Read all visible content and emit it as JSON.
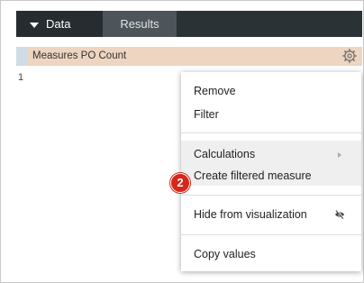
{
  "tabs": [
    {
      "label": "Data",
      "active": true
    },
    {
      "label": "Results",
      "active": false
    }
  ],
  "header": {
    "measure_label": "Measures PO Count"
  },
  "row_number": "1",
  "menu": {
    "remove": "Remove",
    "filter": "Filter",
    "calculations": "Calculations",
    "create_filtered_measure": "Create filtered measure",
    "hide_from_visualization": "Hide from visualization",
    "copy_values": "Copy values"
  },
  "step_badge": "2",
  "colors": {
    "tab_bar": "#2b3236",
    "header_row": "#edd5c1",
    "badge": "#d7271a"
  }
}
